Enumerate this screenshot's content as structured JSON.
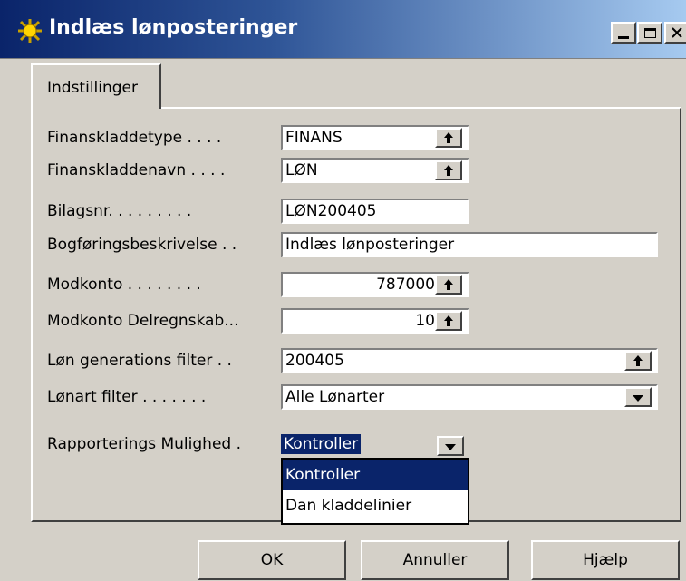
{
  "window": {
    "title": "Indlæs lønposteringer",
    "controls": [
      "minimize-icon",
      "maximize-icon",
      "close-icon"
    ]
  },
  "tab": {
    "label": "Indstillinger"
  },
  "fields": [
    {
      "label": "Finanskladdetype . . . .",
      "value": "FINANS",
      "control": "lookup"
    },
    {
      "label": "Finanskladdenavn . . . .",
      "value": "LØN",
      "control": "lookup"
    },
    {
      "label": "Bilagsnr. . . . . . . . .",
      "value": "LØN200405",
      "control": "text"
    },
    {
      "label": "Bogføringsbeskrivelse . .",
      "value": "Indlæs lønposteringer",
      "control": "text"
    },
    {
      "label": "Modkonto . . . . . . . .",
      "value": "787000",
      "control": "lookup"
    },
    {
      "label": "Modkonto Delregnskab...",
      "value": "10",
      "control": "lookup"
    },
    {
      "label": "Løn generations filter . .",
      "value": "200405",
      "control": "lookup"
    },
    {
      "label": "Lønart filter . . . . . . .",
      "value": "Alle Lønarter",
      "control": "dropdown"
    },
    {
      "label": "Rapporterings Mulighed .",
      "value": "Kontroller",
      "control": "dropdown"
    }
  ],
  "dropdown_options": [
    "Kontroller",
    "Dan kladdelinier"
  ],
  "buttons": {
    "ok": "OK",
    "cancel": "Annuller",
    "help": "Hjælp"
  },
  "colors": {
    "title_start": "#0a246a",
    "title_end": "#a6caf0",
    "face": "#d4d0c8",
    "highlight": "#0a246a"
  }
}
